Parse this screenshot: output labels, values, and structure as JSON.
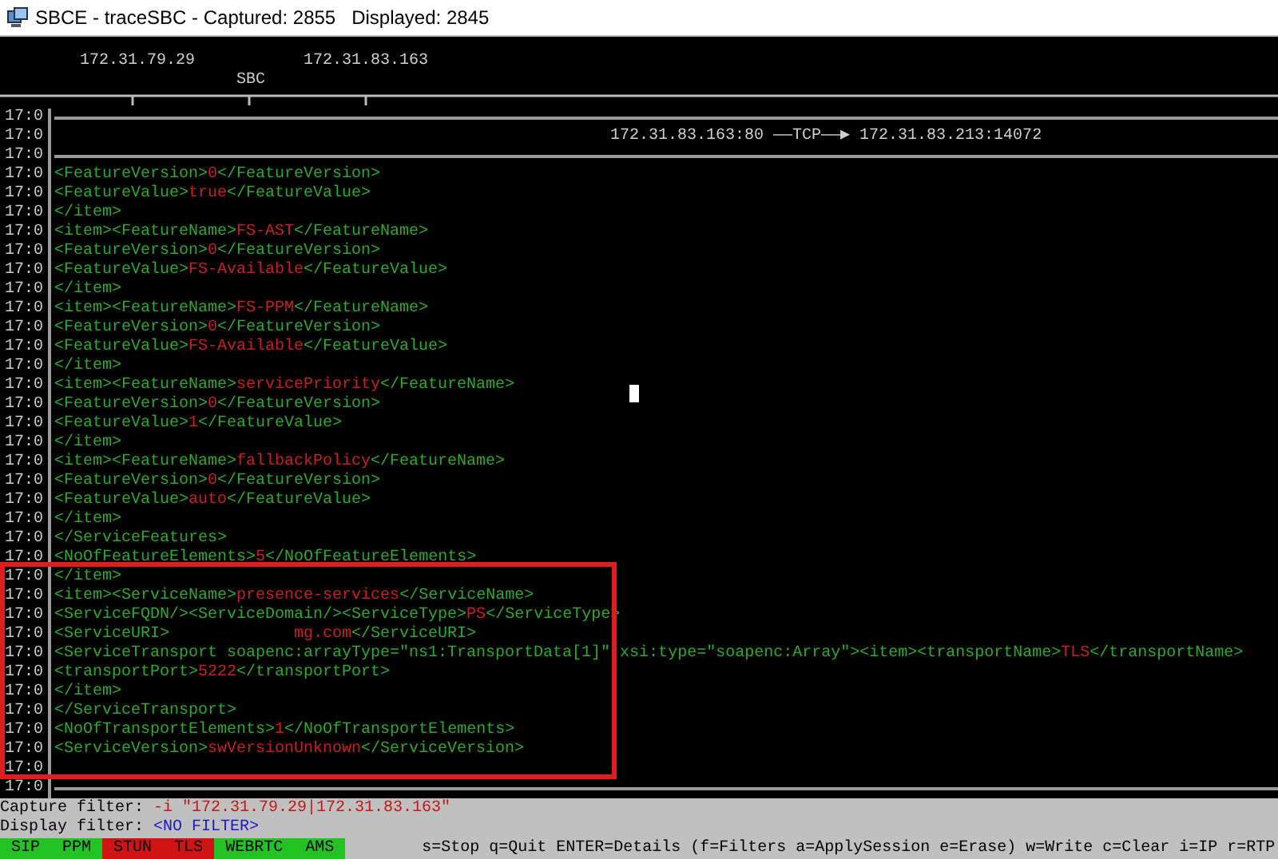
{
  "window": {
    "title": "SBCE - traceSBC - Captured: 2855   Displayed: 2845"
  },
  "header": {
    "hosts": [
      {
        "label": "172.31.79.29"
      },
      {
        "label": "SBC"
      },
      {
        "label": "172.31.83.163"
      }
    ]
  },
  "lines": [
    {
      "time": "17:0",
      "kind": "rule"
    },
    {
      "time": "17:0",
      "kind": "connection",
      "text": "172.31.83.163:80 ——TCP——▶ 172.31.83.213:14072"
    },
    {
      "time": "17:0",
      "kind": "rule"
    },
    {
      "time": "17:0",
      "kind": "xml",
      "segments": [
        {
          "kind": "tag",
          "text": "<FeatureVersion>"
        },
        {
          "kind": "value",
          "text": "0"
        },
        {
          "kind": "tag",
          "text": "</FeatureVersion>"
        }
      ]
    },
    {
      "time": "17:0",
      "kind": "xml",
      "segments": [
        {
          "kind": "tag",
          "text": "<FeatureValue>"
        },
        {
          "kind": "value",
          "text": "true"
        },
        {
          "kind": "tag",
          "text": "</FeatureValue>"
        }
      ]
    },
    {
      "time": "17:0",
      "kind": "xml",
      "segments": [
        {
          "kind": "tag",
          "text": "</item>"
        }
      ]
    },
    {
      "time": "17:0",
      "kind": "xml",
      "segments": [
        {
          "kind": "tag",
          "text": "<item><FeatureName>"
        },
        {
          "kind": "value",
          "text": "FS-AST"
        },
        {
          "kind": "tag",
          "text": "</FeatureName>"
        }
      ]
    },
    {
      "time": "17:0",
      "kind": "xml",
      "segments": [
        {
          "kind": "tag",
          "text": "<FeatureVersion>"
        },
        {
          "kind": "value",
          "text": "0"
        },
        {
          "kind": "tag",
          "text": "</FeatureVersion>"
        }
      ]
    },
    {
      "time": "17:0",
      "kind": "xml",
      "segments": [
        {
          "kind": "tag",
          "text": "<FeatureValue>"
        },
        {
          "kind": "value",
          "text": "FS-Available"
        },
        {
          "kind": "tag",
          "text": "</FeatureValue>"
        }
      ]
    },
    {
      "time": "17:0",
      "kind": "xml",
      "segments": [
        {
          "kind": "tag",
          "text": "</item>"
        }
      ]
    },
    {
      "time": "17:0",
      "kind": "xml",
      "segments": [
        {
          "kind": "tag",
          "text": "<item><FeatureName>"
        },
        {
          "kind": "value",
          "text": "FS-PPM"
        },
        {
          "kind": "tag",
          "text": "</FeatureName>"
        }
      ]
    },
    {
      "time": "17:0",
      "kind": "xml",
      "segments": [
        {
          "kind": "tag",
          "text": "<FeatureVersion>"
        },
        {
          "kind": "value",
          "text": "0"
        },
        {
          "kind": "tag",
          "text": "</FeatureVersion>"
        }
      ]
    },
    {
      "time": "17:0",
      "kind": "xml",
      "segments": [
        {
          "kind": "tag",
          "text": "<FeatureValue>"
        },
        {
          "kind": "value",
          "text": "FS-Available"
        },
        {
          "kind": "tag",
          "text": "</FeatureValue>"
        }
      ]
    },
    {
      "time": "17:0",
      "kind": "xml",
      "segments": [
        {
          "kind": "tag",
          "text": "</item>"
        }
      ]
    },
    {
      "time": "17:0",
      "kind": "xml",
      "segments": [
        {
          "kind": "tag",
          "text": "<item><FeatureName>"
        },
        {
          "kind": "value",
          "text": "servicePriority"
        },
        {
          "kind": "tag",
          "text": "</FeatureName>"
        }
      ]
    },
    {
      "time": "17:0",
      "kind": "xml",
      "segments": [
        {
          "kind": "tag",
          "text": "<FeatureVersion>"
        },
        {
          "kind": "value",
          "text": "0"
        },
        {
          "kind": "tag",
          "text": "</FeatureVersion>"
        }
      ]
    },
    {
      "time": "17:0",
      "kind": "xml",
      "segments": [
        {
          "kind": "tag",
          "text": "<FeatureValue>"
        },
        {
          "kind": "value",
          "text": "1"
        },
        {
          "kind": "tag",
          "text": "</FeatureValue>"
        }
      ]
    },
    {
      "time": "17:0",
      "kind": "xml",
      "segments": [
        {
          "kind": "tag",
          "text": "</item>"
        }
      ]
    },
    {
      "time": "17:0",
      "kind": "xml",
      "segments": [
        {
          "kind": "tag",
          "text": "<item><FeatureName>"
        },
        {
          "kind": "value",
          "text": "fallbackPolicy"
        },
        {
          "kind": "tag",
          "text": "</FeatureName>"
        }
      ]
    },
    {
      "time": "17:0",
      "kind": "xml",
      "segments": [
        {
          "kind": "tag",
          "text": "<FeatureVersion>"
        },
        {
          "kind": "value",
          "text": "0"
        },
        {
          "kind": "tag",
          "text": "</FeatureVersion>"
        }
      ]
    },
    {
      "time": "17:0",
      "kind": "xml",
      "segments": [
        {
          "kind": "tag",
          "text": "<FeatureValue>"
        },
        {
          "kind": "value",
          "text": "auto"
        },
        {
          "kind": "tag",
          "text": "</FeatureValue>"
        }
      ]
    },
    {
      "time": "17:0",
      "kind": "xml",
      "segments": [
        {
          "kind": "tag",
          "text": "</item>"
        }
      ]
    },
    {
      "time": "17:0",
      "kind": "xml",
      "segments": [
        {
          "kind": "tag",
          "text": "</ServiceFeatures>"
        }
      ]
    },
    {
      "time": "17:0",
      "kind": "xml",
      "segments": [
        {
          "kind": "tag",
          "text": "<NoOfFeatureElements>"
        },
        {
          "kind": "value",
          "text": "5"
        },
        {
          "kind": "tag",
          "text": "</NoOfFeatureElements>"
        }
      ]
    },
    {
      "time": "17:0",
      "kind": "xml",
      "segments": [
        {
          "kind": "tag",
          "text": "</item>"
        }
      ]
    },
    {
      "time": "17:0",
      "kind": "xml",
      "segments": [
        {
          "kind": "tag",
          "text": "<item><ServiceName>"
        },
        {
          "kind": "value",
          "text": "presence-services"
        },
        {
          "kind": "tag",
          "text": "</ServiceName>"
        }
      ]
    },
    {
      "time": "17:0",
      "kind": "xml",
      "segments": [
        {
          "kind": "tag",
          "text": "<ServiceFQDN/><ServiceDomain/><ServiceType>"
        },
        {
          "kind": "value",
          "text": "PS"
        },
        {
          "kind": "tag",
          "text": "</ServiceType>"
        }
      ]
    },
    {
      "time": "17:0",
      "kind": "xml",
      "segments": [
        {
          "kind": "tag",
          "text": "<ServiceURI>"
        },
        {
          "kind": "value",
          "text": "             mg.com"
        },
        {
          "kind": "tag",
          "text": "</ServiceURI>"
        }
      ]
    },
    {
      "time": "17:0",
      "kind": "xml",
      "segments": [
        {
          "kind": "tag",
          "text": "<ServiceTransport soapenc:arrayType=\"ns1:TransportData[1]\" xsi:type=\"soapenc:Array\"><item><transportName>"
        },
        {
          "kind": "value",
          "text": "TLS"
        },
        {
          "kind": "tag",
          "text": "</transportName>"
        }
      ]
    },
    {
      "time": "17:0",
      "kind": "xml",
      "segments": [
        {
          "kind": "tag",
          "text": "<transportPort>"
        },
        {
          "kind": "value",
          "text": "5222"
        },
        {
          "kind": "tag",
          "text": "</transportPort>"
        }
      ]
    },
    {
      "time": "17:0",
      "kind": "xml",
      "segments": [
        {
          "kind": "tag",
          "text": "</item>"
        }
      ]
    },
    {
      "time": "17:0",
      "kind": "xml",
      "segments": [
        {
          "kind": "tag",
          "text": "</ServiceTransport>"
        }
      ]
    },
    {
      "time": "17:0",
      "kind": "xml",
      "segments": [
        {
          "kind": "tag",
          "text": "<NoOfTransportElements>"
        },
        {
          "kind": "value",
          "text": "1"
        },
        {
          "kind": "tag",
          "text": "</NoOfTransportElements>"
        }
      ]
    },
    {
      "time": "17:0",
      "kind": "xml",
      "segments": [
        {
          "kind": "tag",
          "text": "<ServiceVersion>"
        },
        {
          "kind": "value",
          "text": "swVersionUnknown"
        },
        {
          "kind": "tag",
          "text": "</ServiceVersion>"
        }
      ]
    },
    {
      "time": "17:0",
      "kind": "blank"
    },
    {
      "time": "17:0",
      "kind": "rule"
    }
  ],
  "capture_filter": {
    "label": "Capture filter:",
    "value": "-i \"172.31.79.29|172.31.83.163\""
  },
  "display_filter": {
    "label": "Display filter:",
    "value": "<NO FILTER>"
  },
  "protocol_tabs": [
    {
      "label": "SIP",
      "color": "#22c322"
    },
    {
      "label": "PPM",
      "color": "#22c322"
    },
    {
      "label": "STUN",
      "color": "#d01414"
    },
    {
      "label": "TLS",
      "color": "#d01414"
    },
    {
      "label": "WEBRTC",
      "color": "#22c322"
    },
    {
      "label": "AMS",
      "color": "#22c322"
    }
  ],
  "help_text": "s=Stop q=Quit ENTER=Details (f=Filters a=ApplySession e=Erase) w=Write c=Clear i=IP r=RTP"
}
